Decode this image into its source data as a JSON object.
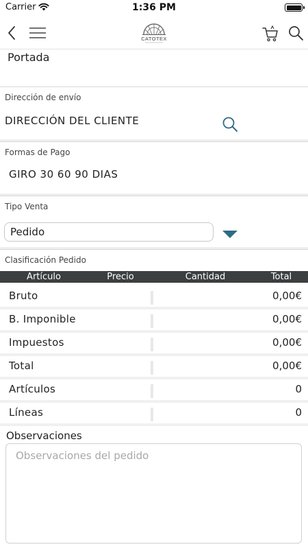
{
  "status_bar": {
    "carrier": "Carrier",
    "time": "1:36 PM"
  },
  "nav": {
    "logo_text": "CATOTEX",
    "icons": [
      "back-icon",
      "menu-icon",
      "logo-icon",
      "cart-icon",
      "search-icon"
    ]
  },
  "breadcrumb": {
    "label": "Portada"
  },
  "shipping": {
    "label": "Dirección de envío",
    "value": "DIRECCIÓN DEL CLIENTE"
  },
  "payment": {
    "label": "Formas de Pago",
    "value": "GIRO 30 60 90 DIAS"
  },
  "sale_type": {
    "label": "Tipo Venta",
    "selected": "Pedido"
  },
  "classification": {
    "label": "Clasificación Pedido"
  },
  "table": {
    "headers": [
      "Artículo",
      "Precio",
      "Cantidad",
      "Total"
    ]
  },
  "totals": {
    "rows": [
      {
        "label": "Bruto",
        "value": "0,00€"
      },
      {
        "label": "B. Imponible",
        "value": "0,00€"
      },
      {
        "label": "Impuestos",
        "value": "0,00€"
      },
      {
        "label": "Total",
        "value": "0,00€"
      },
      {
        "label": "Artículos",
        "value": "0"
      },
      {
        "label": "Líneas",
        "value": "0"
      }
    ]
  },
  "observations": {
    "label": "Observaciones",
    "placeholder": "Observaciones del pedido",
    "value": ""
  },
  "colors": {
    "accent": "#2f6b86",
    "table_header": "#3b3f40"
  }
}
